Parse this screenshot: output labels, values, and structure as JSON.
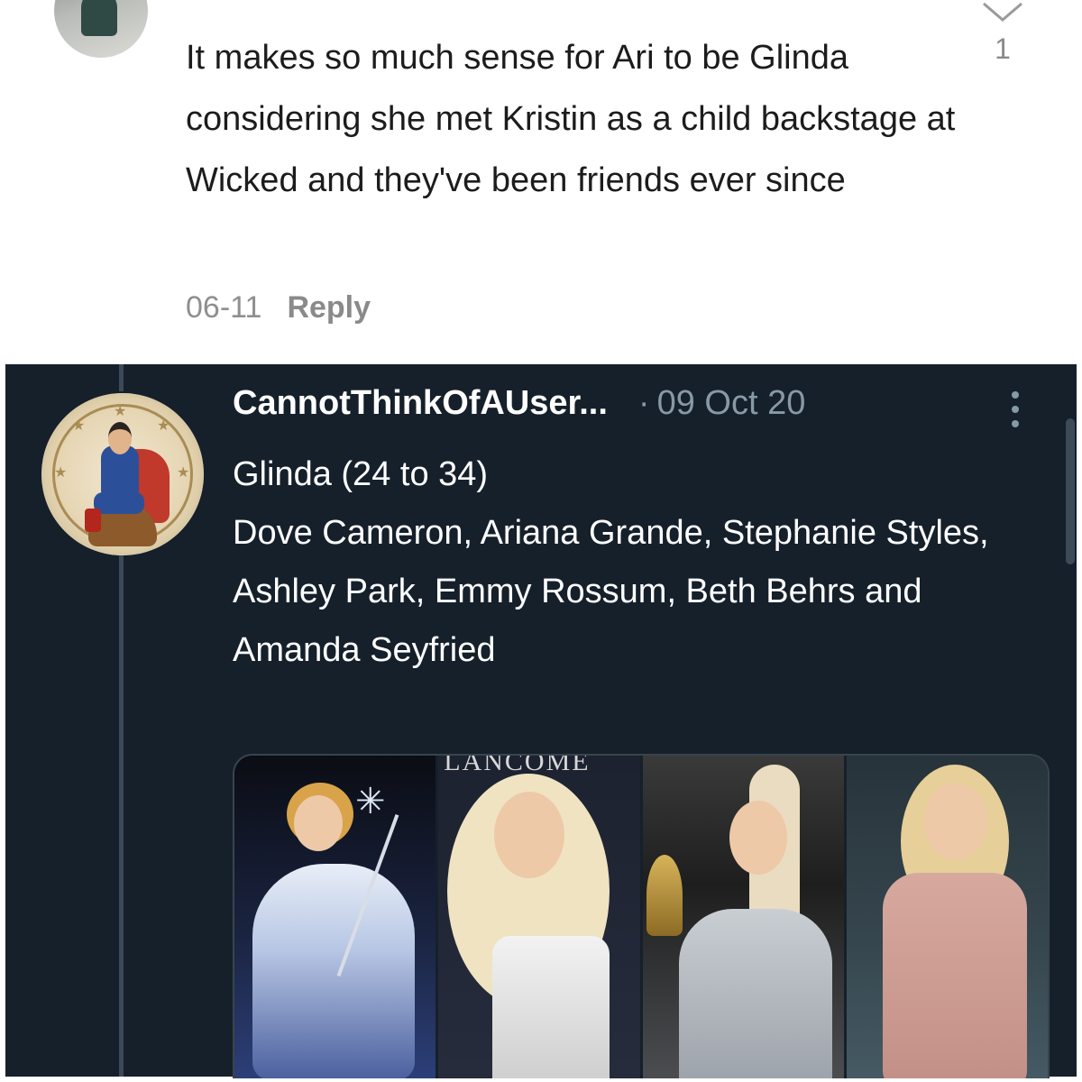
{
  "top_comment": {
    "text": "It makes so much sense for Ari to be Glinda considering she met Kristin as a child backstage at Wicked and they've been friends ever since",
    "date": "06-11",
    "reply_label": "Reply",
    "like_count": "1"
  },
  "tweet": {
    "display_name": "CannotThinkOfAUser...",
    "separator": "·",
    "date": "09 Oct 20",
    "title_line": "Glinda (24 to 34)",
    "body": "Dove Cameron, Ariana Grande, Stephanie Styles, Ashley Park, Emmy Rossum, Beth Behrs and Amanda Seyfried",
    "photo_1_sign": "LANCOME"
  },
  "colors": {
    "dark_bg": "#15202b",
    "secondary_text": "#8899a6",
    "thread_line": "#3a4a59"
  }
}
